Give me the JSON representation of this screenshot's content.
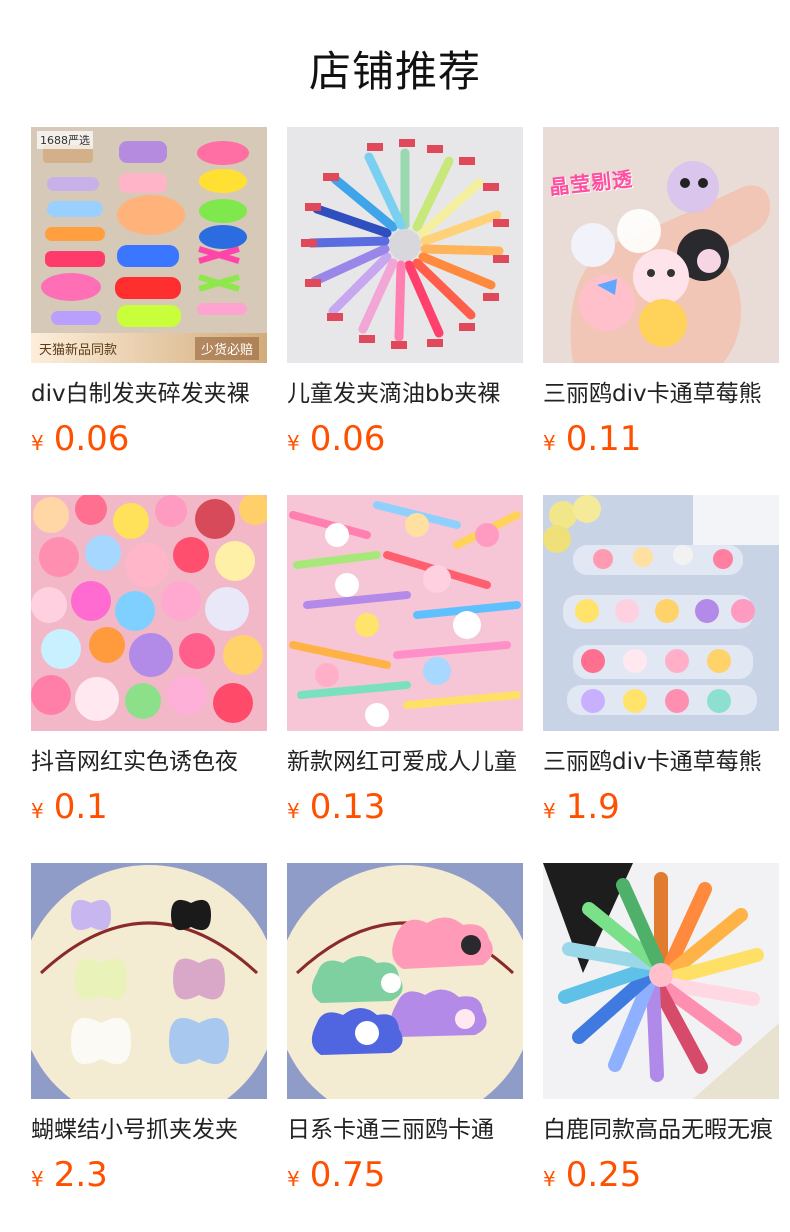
{
  "section_title": "店铺推荐",
  "currency_symbol": "¥",
  "products": [
    {
      "name": "div白制发夹碎发夹裸",
      "price": "0.06",
      "image_icon": "hair-clips-assorted-image",
      "badge": "1688严选",
      "banner_left": "天猫新品同款",
      "banner_right": "少货必赔"
    },
    {
      "name": "儿童发夹滴油bb夹裸",
      "price": "0.06",
      "image_icon": "hair-clips-color-wheel-image"
    },
    {
      "name": "三丽鸥div卡通草莓熊",
      "price": "0.11",
      "image_icon": "cartoon-charms-hand-image",
      "overlay": "晶莹剔透"
    },
    {
      "name": "抖音网红实色诱色夜",
      "price": "0.1",
      "image_icon": "resin-charms-pile-image"
    },
    {
      "name": "新款网红可爱成人儿童",
      "price": "0.13",
      "image_icon": "cartoon-hair-clips-pile-image"
    },
    {
      "name": "三丽鸥div卡通草莓熊",
      "price": "1.9",
      "image_icon": "claw-clips-display-image"
    },
    {
      "name": "蝴蝶结小号抓夹发夹",
      "price": "2.3",
      "image_icon": "bow-claw-clips-plate-image"
    },
    {
      "name": "日系卡通三丽鸥卡通",
      "price": "0.75",
      "image_icon": "cloud-hair-clips-plate-image"
    },
    {
      "name": "白鹿同款高品无暇无痕",
      "price": "0.25",
      "image_icon": "duckbill-clips-wheel-image"
    }
  ]
}
